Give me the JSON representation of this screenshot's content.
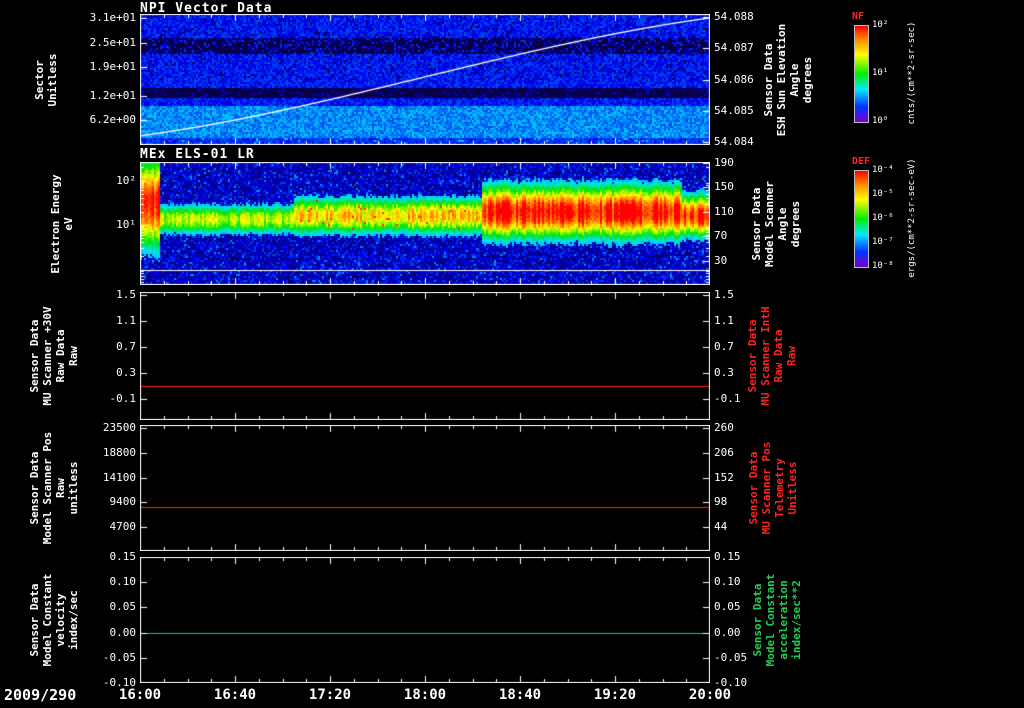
{
  "x_axis": {
    "date_label": "2009/290",
    "tick_labels": [
      "16:00",
      "16:40",
      "17:20",
      "18:00",
      "18:40",
      "19:20",
      "20:00"
    ],
    "minor_per_major": 4
  },
  "colorbars": [
    {
      "name": "NF",
      "name_color": "#ff2222",
      "units": "cnts/(cm**2-sr-sec)",
      "tick_labels": [
        "10²",
        "10¹",
        "10⁰"
      ]
    },
    {
      "name": "DEF",
      "name_color": "#ff2222",
      "units": "ergs/(cm**2-sr-sec-eV)",
      "tick_labels": [
        "10⁻⁴",
        "10⁻⁵",
        "10⁻⁶",
        "10⁻⁷",
        "10⁻⁸"
      ]
    }
  ],
  "chart_data": [
    {
      "type": "heatmap",
      "title": "NPI Vector Data",
      "left_label_lines": [
        "Sector",
        "Unitless"
      ],
      "left_ticks": [
        {
          "v": 31,
          "label": "3.1e+01"
        },
        {
          "v": 25,
          "label": "2.5e+01"
        },
        {
          "v": 19,
          "label": "1.9e+01"
        },
        {
          "v": 12,
          "label": "1.2e+01"
        },
        {
          "v": 6.2,
          "label": "6.2e+00"
        }
      ],
      "left_range": [
        32,
        0
      ],
      "right_label_lines": [
        "Sensor Data",
        "ESH Sun Elevation",
        "Angle",
        "degrees"
      ],
      "right_label_color": "#ffffff",
      "right_ticks": [
        {
          "v": 54.088,
          "label": "54.088"
        },
        {
          "v": 54.087,
          "label": "54.087"
        },
        {
          "v": 54.086,
          "label": "54.086"
        },
        {
          "v": 54.085,
          "label": "54.085"
        },
        {
          "v": 54.084,
          "label": "54.084"
        }
      ],
      "right_range": [
        54.0881,
        54.0839
      ],
      "colorbar": "NF",
      "overlay_line": {
        "name": "ESH Sun Elevation Angle",
        "color": "#ffffff",
        "start": 54.084,
        "end": 54.088,
        "axis": "right"
      },
      "content_note": "blue count-rate noise; black bands near sectors 22-25 and 12-13; brighter cyan-blue below sector 9; white sun-elevation trace rises 54.084 to 54.088 across interval"
    },
    {
      "type": "heatmap",
      "title": "MEx ELS-01 LR",
      "left_label_lines": [
        "Electron Energy",
        "eV"
      ],
      "left_scale": "log10",
      "left_ticks": [
        {
          "v": 2,
          "label": "10²"
        },
        {
          "v": 1,
          "label": "10¹"
        }
      ],
      "left_range": [
        2.42,
        -0.36
      ],
      "right_label_lines": [
        "Sensor Data",
        "Model Scanner",
        "Angle",
        "degrees"
      ],
      "right_label_color": "#ffffff",
      "right_ticks": [
        {
          "v": 190,
          "label": "190"
        },
        {
          "v": 150,
          "label": "150"
        },
        {
          "v": 110,
          "label": "110"
        },
        {
          "v": 70,
          "label": "70"
        },
        {
          "v": 30,
          "label": "30"
        }
      ],
      "right_range": [
        191,
        -10
      ],
      "colorbar": "DEF",
      "content_note": "electron flux band near 10-40 eV through whole interval; intense broad red burst at 16:00-16:03; green-yellow band 16:05-18:25 with red speckles; bright red band 18:25-20:00; thin white line near bottom"
    },
    {
      "type": "line",
      "title": "",
      "left_label_lines": [
        "Sensor Data",
        "MU Scanner +30V",
        "Raw Data",
        "Raw"
      ],
      "left_ticks": [
        {
          "v": 1.5,
          "label": "1.5"
        },
        {
          "v": 1.1,
          "label": "1.1"
        },
        {
          "v": 0.7,
          "label": "0.7"
        },
        {
          "v": 0.3,
          "label": "0.3"
        },
        {
          "v": -0.1,
          "label": "-0.1"
        }
      ],
      "left_range": [
        1.55,
        -0.43
      ],
      "right_label_lines": [
        "Sensor Data",
        "MU Scanner IntH",
        "Raw Data",
        "Raw"
      ],
      "right_label_color": "#ff2222",
      "right_ticks": [
        {
          "v": 1.5,
          "label": "1.5"
        },
        {
          "v": 1.1,
          "label": "1.1"
        },
        {
          "v": 0.7,
          "label": "0.7"
        },
        {
          "v": 0.3,
          "label": "0.3"
        },
        {
          "v": -0.1,
          "label": "-0.1"
        }
      ],
      "right_range": [
        1.55,
        -0.43
      ],
      "series": [
        {
          "name": "MU Scanner +30V Raw",
          "color": "#ff2222",
          "constant_value": 0.1
        }
      ]
    },
    {
      "type": "line",
      "title": "",
      "left_label_lines": [
        "Sensor Data",
        "Model Scanner Pos",
        "Raw",
        "unitless"
      ],
      "left_ticks": [
        {
          "v": 23500,
          "label": "23500"
        },
        {
          "v": 18800,
          "label": "18800"
        },
        {
          "v": 14100,
          "label": "14100"
        },
        {
          "v": 9400,
          "label": "9400"
        },
        {
          "v": 4700,
          "label": "4700"
        }
      ],
      "left_range": [
        24100,
        150
      ],
      "right_label_lines": [
        "Sensor Data",
        "MU Scanner Pos",
        "Telemetry",
        "Unitless"
      ],
      "right_label_color": "#ff2222",
      "right_ticks": [
        {
          "v": 260,
          "label": "260"
        },
        {
          "v": 206,
          "label": "206"
        },
        {
          "v": 152,
          "label": "152"
        },
        {
          "v": 98,
          "label": "98"
        },
        {
          "v": 44,
          "label": "44"
        }
      ],
      "right_range": [
        267,
        -8
      ],
      "series": [
        {
          "name": "Model Scanner Pos Raw",
          "color": "#ff2222",
          "constant_value": 8500
        }
      ]
    },
    {
      "type": "line",
      "title": "",
      "left_label_lines": [
        "Sensor Data",
        "Model Constant",
        "velocity",
        "index/sec"
      ],
      "left_ticks": [
        {
          "v": 0.15,
          "label": "0.15"
        },
        {
          "v": 0.1,
          "label": "0.10"
        },
        {
          "v": 0.05,
          "label": "0.05"
        },
        {
          "v": 0.0,
          "label": "0.00"
        },
        {
          "v": -0.05,
          "label": "-0.05"
        },
        {
          "v": -0.1,
          "label": "-0.10"
        }
      ],
      "left_range": [
        0.15,
        -0.1
      ],
      "right_label_lines": [
        "Sensor Data",
        "Model Constant",
        "acceleration",
        "index/sec**2"
      ],
      "right_label_color": "#22cc55",
      "right_ticks": [
        {
          "v": 0.15,
          "label": "0.15"
        },
        {
          "v": 0.1,
          "label": "0.10"
        },
        {
          "v": 0.05,
          "label": "0.05"
        },
        {
          "v": 0.0,
          "label": "0.00"
        },
        {
          "v": -0.05,
          "label": "-0.05"
        },
        {
          "v": -0.1,
          "label": "-0.10"
        }
      ],
      "right_range": [
        0.15,
        -0.1
      ],
      "series": [
        {
          "name": "Model Constant velocity",
          "color": "#22cc55",
          "constant_value": 0.0
        }
      ]
    }
  ]
}
